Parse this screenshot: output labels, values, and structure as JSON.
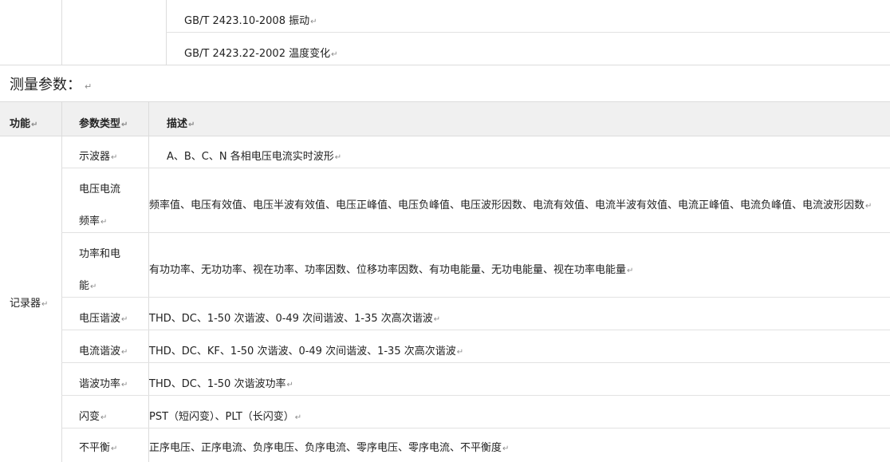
{
  "standards": [
    "GB/T 2423.10-2008 振动",
    "GB/T 2423.22-2002 温度变化"
  ],
  "section_title": "测量参数：",
  "table": {
    "headers": {
      "function": "功能",
      "param_type": "参数类型",
      "description": "描述"
    },
    "function_label": "记录器",
    "rows": [
      {
        "type_lines": [
          "示波器"
        ],
        "desc": "A、B、C、N 各相电压电流实时波形"
      },
      {
        "type_lines": [
          "电压电流",
          "频率"
        ],
        "desc": "频率值、电压有效值、电压半波有效值、电压正峰值、电压负峰值、电压波形因数、电流有效值、电流半波有效值、电流正峰值、电流负峰值、电流波形因数"
      },
      {
        "type_lines": [
          "功率和电",
          "能"
        ],
        "desc": "有功功率、无功功率、视在功率、功率因数、位移功率因数、有功电能量、无功电能量、视在功率电能量"
      },
      {
        "type_lines": [
          "电压谐波"
        ],
        "desc": "THD、DC、1-50 次谐波、0-49 次间谐波、1-35 次高次谐波"
      },
      {
        "type_lines": [
          "电流谐波"
        ],
        "desc": "THD、DC、KF、1-50 次谐波、0-49 次间谐波、1-35 次高次谐波"
      },
      {
        "type_lines": [
          "谐波功率"
        ],
        "desc": "THD、DC、1-50 次谐波功率"
      },
      {
        "type_lines": [
          "闪变"
        ],
        "desc": "PST（短闪变）、PLT（长闪变）"
      },
      {
        "type_lines": [
          "不平衡"
        ],
        "desc": "正序电压、正序电流、负序电压、负序电流、零序电压、零序电流、不平衡度"
      }
    ]
  }
}
